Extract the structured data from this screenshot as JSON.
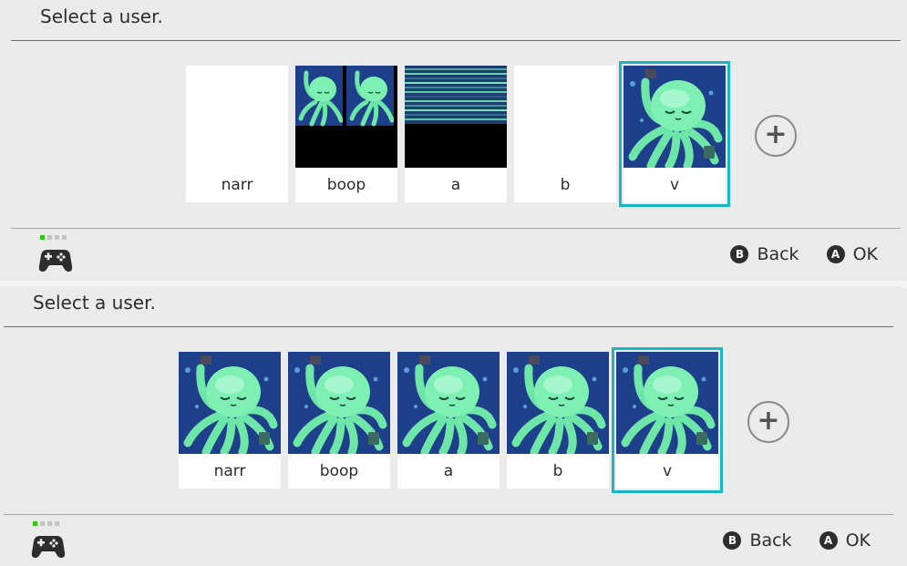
{
  "screens": [
    {
      "title": "Select a user.",
      "users": [
        {
          "name": "narr",
          "avatar": "blank"
        },
        {
          "name": "boop",
          "avatar": "split-octopus"
        },
        {
          "name": "a",
          "avatar": "glitch"
        },
        {
          "name": "b",
          "avatar": "blank"
        },
        {
          "name": "v",
          "avatar": "octopus",
          "selected": true
        }
      ],
      "add_icon": "plus-icon",
      "controller_icon": "gamepad-icon",
      "back": {
        "key": "B",
        "label": "Back"
      },
      "ok": {
        "key": "A",
        "label": "OK"
      }
    },
    {
      "title": "Select a user.",
      "users": [
        {
          "name": "narr",
          "avatar": "octopus"
        },
        {
          "name": "boop",
          "avatar": "octopus"
        },
        {
          "name": "a",
          "avatar": "octopus"
        },
        {
          "name": "b",
          "avatar": "octopus"
        },
        {
          "name": "v",
          "avatar": "octopus",
          "selected": true
        }
      ],
      "add_icon": "plus-icon",
      "controller_icon": "gamepad-icon",
      "back": {
        "key": "B",
        "label": "Back"
      },
      "ok": {
        "key": "A",
        "label": "OK"
      }
    }
  ],
  "colors": {
    "selection": "#19b6c4",
    "player_indicator": "#33c319",
    "background": "#ebebeb"
  }
}
